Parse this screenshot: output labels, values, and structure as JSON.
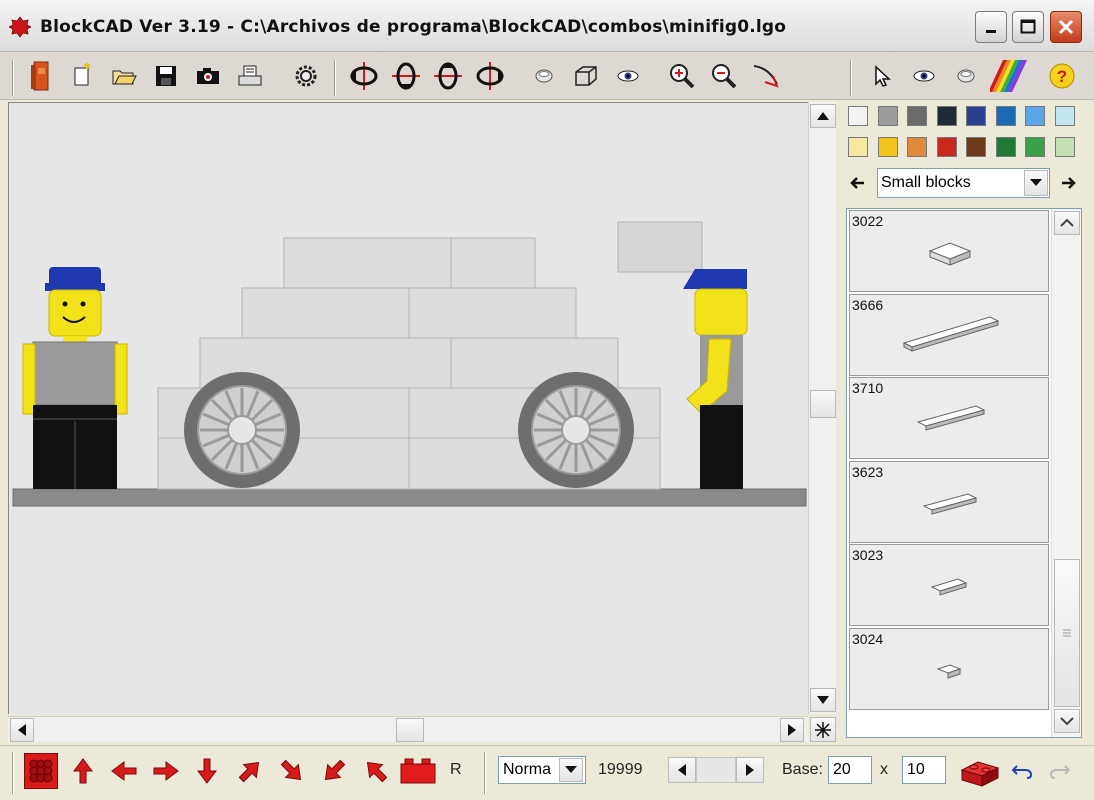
{
  "window": {
    "title": "BlockCAD Ver 3.19 - C:\\Archivos de programa\\BlockCAD\\combos\\minifig0.lgo"
  },
  "toolbar": {
    "icons": [
      "brick-icon",
      "new-file-icon",
      "open-folder-icon",
      "save-icon",
      "camera-icon",
      "print-icon",
      "settings-gear-icon",
      "rotate-left-icon",
      "rotate-down-icon",
      "rotate-up-icon",
      "rotate-right-icon",
      "smooth-view-icon",
      "wireframe-icon",
      "eye-icon",
      "zoom-in-icon",
      "zoom-out-icon",
      "pan-icon",
      "pointer-icon",
      "view-eye-icon",
      "shade-icon",
      "colors-rainbow-icon",
      "help-icon"
    ]
  },
  "palette": {
    "colors_row1": [
      "#f2f2f2",
      "#9c9c9c",
      "#6b6b6b",
      "#1f2a36",
      "#2a3f8f",
      "#1a6ab5",
      "#5aa6e8",
      "#bfe6f0"
    ],
    "colors_row2": [
      "#f6e7a0",
      "#f2c21e",
      "#de8a3a",
      "#c8281e",
      "#6b3a1a",
      "#1f7a3a",
      "#3aa04a",
      "#c4dfb4"
    ]
  },
  "category": {
    "selected": "Small blocks"
  },
  "parts": [
    {
      "id": "3022"
    },
    {
      "id": "3666"
    },
    {
      "id": "3710"
    },
    {
      "id": "3623"
    },
    {
      "id": "3023"
    },
    {
      "id": "3024"
    }
  ],
  "bottom": {
    "mode": "Norma",
    "count": "19999",
    "base_label": "Base:",
    "base_x": "20",
    "times": "x",
    "base_y": "10",
    "rotate_label": "R"
  },
  "accent": "#cc1c1c"
}
